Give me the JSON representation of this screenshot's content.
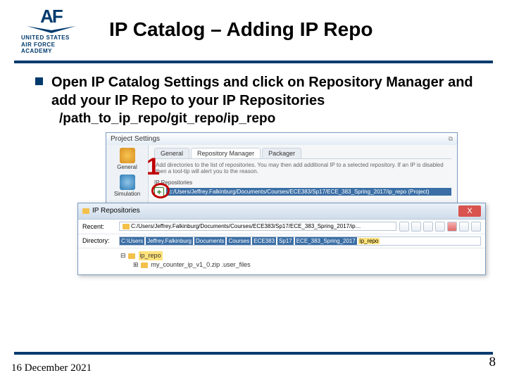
{
  "logo": {
    "mark": "AF",
    "line1": "UNITED STATES",
    "line2": "AIR FORCE",
    "line3": "ACADEMY"
  },
  "title": "IP Catalog – Adding IP Repo",
  "bullet": "Open IP Catalog Settings and click on Repository Manager and add your IP Repo to your IP Repositories",
  "path": "/path_to_ip_repo/git_repo/ip_repo",
  "callout1": "1",
  "dlg1": {
    "title": "Project Settings",
    "side": {
      "general": "General",
      "simulation": "Simulation"
    },
    "tabs": {
      "general": "General",
      "repo": "Repository Manager",
      "packager": "Packager"
    },
    "desc": "Add directories to the list of repositories. You may then add additional IP to a selected repository. If an IP is disabled then a tool-tip will alert you to the reason.",
    "repo_label": "IP Repositories",
    "repo_value": "c:/Users/Jeffrey.Falkinburg/Documents/Courses/ECE383/Sp17/ECE_383_Spring_2017/ip_repo (Project)"
  },
  "dlg2": {
    "title": "IP Repositories",
    "recent_lbl": "Recent:",
    "recent_val": "C:/Users/Jeffrey.Falkinburg/Documents/Courses/ECE383/Sp17/ECE_383_Spring_2017/ip…",
    "dir_lbl": "Directory:",
    "dir_segments": [
      "C:\\Users",
      "Jeffrey.Falkinburg",
      "Documents",
      "Courses",
      "ECE383",
      "Sp17",
      "ECE_383_Spring_2017"
    ],
    "dir_last": "ip_repo",
    "tree": {
      "folder": "ip_repo",
      "file": "my_counter_ip_v1_0.zip .user_files"
    }
  },
  "footer": {
    "date": "16 December 2021",
    "page": "8"
  }
}
